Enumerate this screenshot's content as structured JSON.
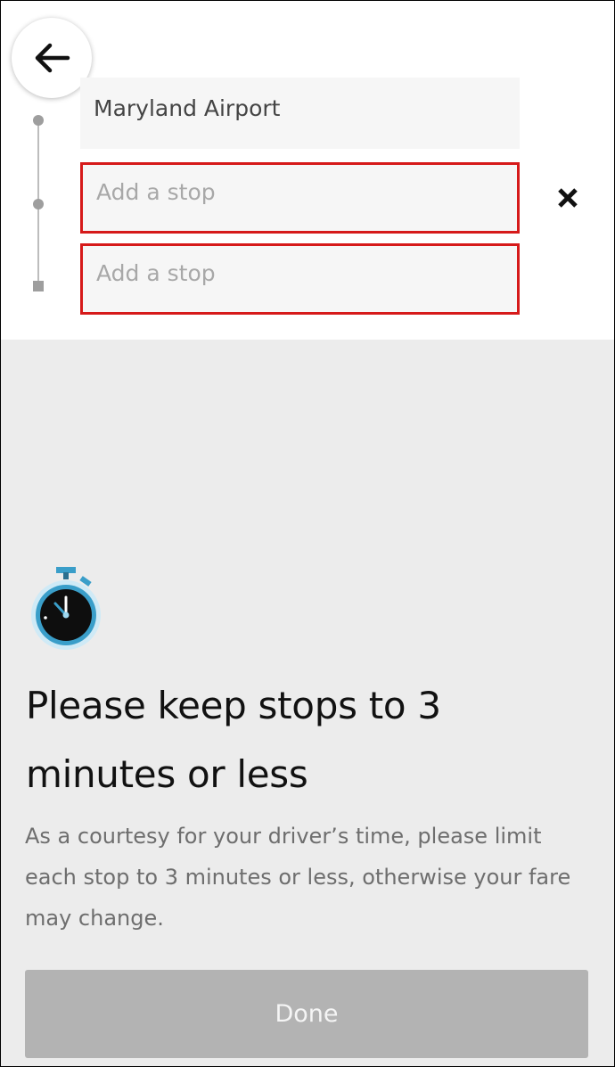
{
  "route": {
    "pickup_value": "Maryland Airport",
    "stops": [
      {
        "placeholder": "Add a stop"
      },
      {
        "placeholder": "Add a stop"
      }
    ]
  },
  "notice": {
    "title": "Please keep stops to 3 minutes or less",
    "body": "As a courtesy for your driver’s time, please limit each stop to 3 minutes or less, otherwise your fare may change."
  },
  "done_label": "Done",
  "icons": {
    "back": "arrow-left-icon",
    "remove_stop": "close-icon",
    "notice": "stopwatch-icon"
  },
  "colors": {
    "highlight_border": "#d61a1a",
    "done_button_bg": "#b3b3b3",
    "stopwatch_accent": "#3a9ec9",
    "panel_bg": "#ececec"
  }
}
